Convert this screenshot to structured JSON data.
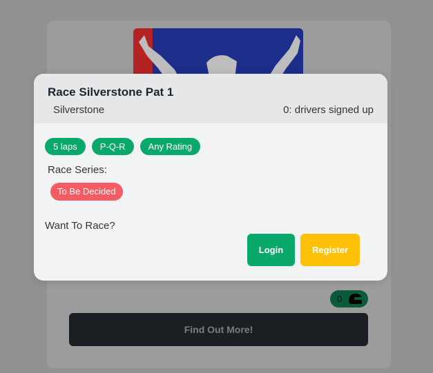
{
  "modal": {
    "title": "Race Silverstone Pat 1",
    "track": "Silverstone",
    "signed_up": "0: drivers signed up",
    "tags": [
      "5 laps",
      "P-Q-R",
      "Any Rating"
    ],
    "series_label": "Race Series:",
    "series_badge": "To Be Decided",
    "want_to_race": "Want To Race?",
    "login_label": "Login",
    "register_label": "Register"
  },
  "background": {
    "driver_count": "0",
    "find_out_more_label": "Find Out More!"
  },
  "colors": {
    "accent_green": "#0aa86b",
    "register_yellow": "#ffc107",
    "series_red": "#f55b62"
  }
}
